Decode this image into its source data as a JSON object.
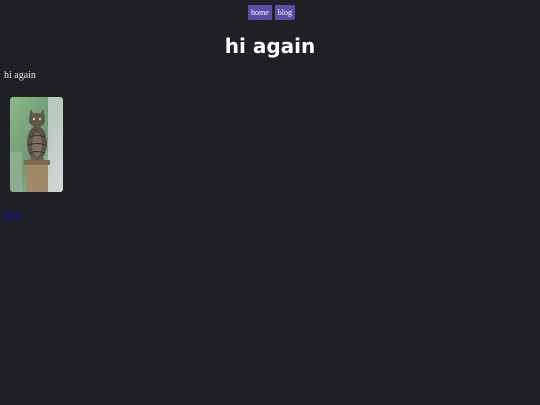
{
  "nav": {
    "items": [
      {
        "label": "home"
      },
      {
        "label": "blog"
      }
    ]
  },
  "page": {
    "title": "hi again",
    "paragraph": "hi again",
    "back_link": "back"
  },
  "colors": {
    "background": "#1f2126",
    "nav_button": "#5b4ea8",
    "link": "#1a0dab"
  }
}
